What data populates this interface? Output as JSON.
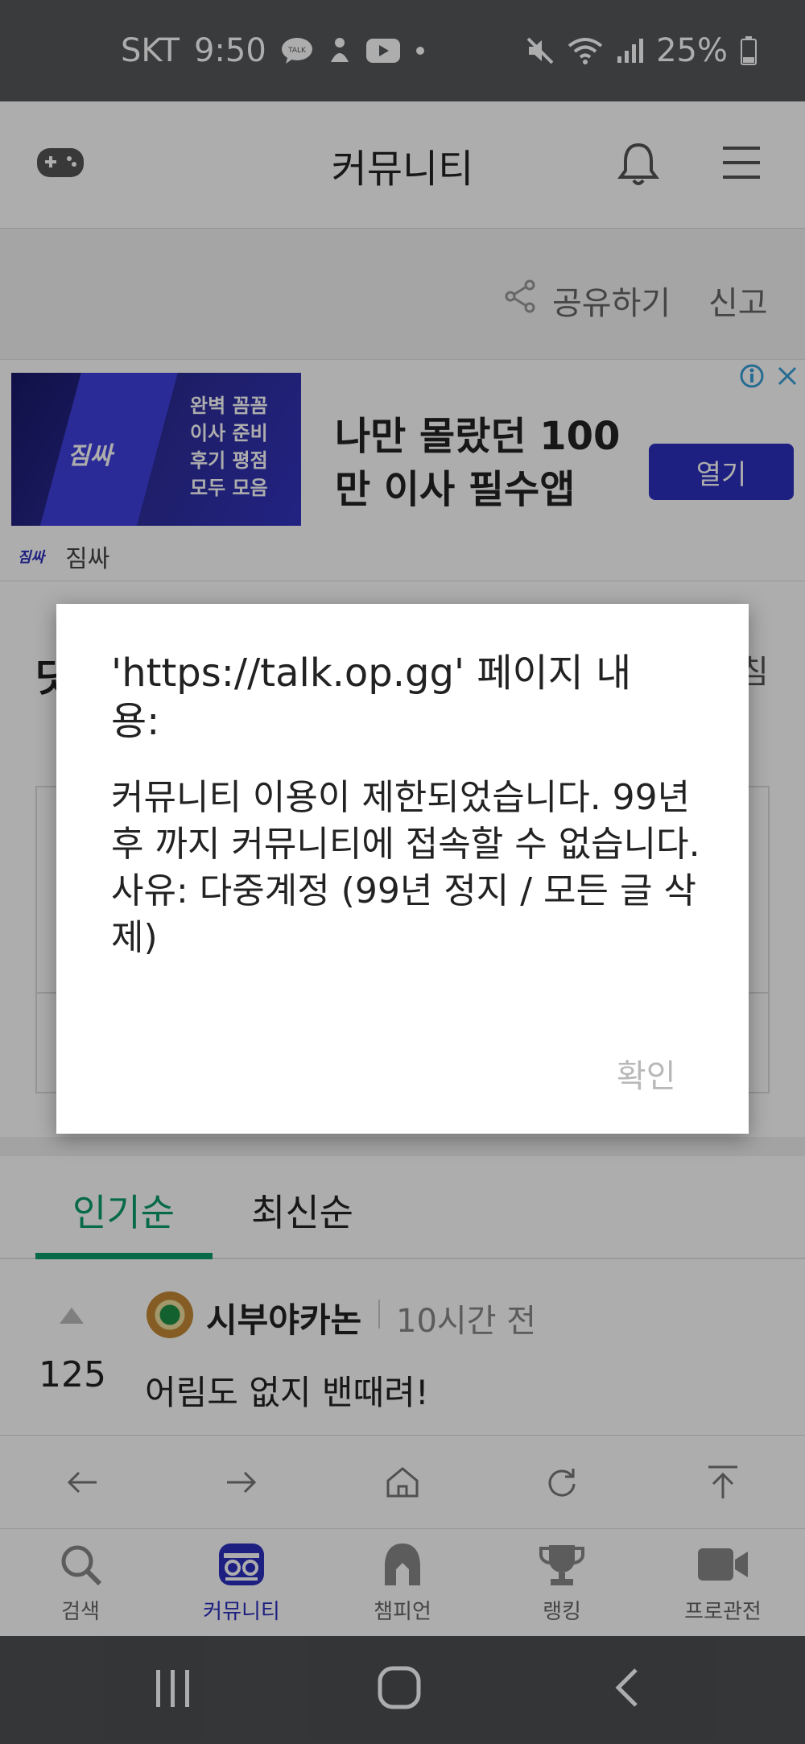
{
  "status_bar": {
    "carrier": "SKT",
    "time": "9:50",
    "talk_badge": "TALK",
    "battery": "25%"
  },
  "header": {
    "title": "커뮤니티"
  },
  "post_actions": {
    "share_label": "공유하기",
    "report_label": "신고"
  },
  "ad": {
    "image_logo": "짐싸",
    "image_copy": [
      "완벽 꼼꼼",
      "이사 준비",
      "후기 평점",
      "모두 모음"
    ],
    "headline": "나만 몰랐던 100만 이사 필수앱",
    "open_label": "열기",
    "sponsor_mini": "짐싸",
    "sponsor_name": "짐싸"
  },
  "background": {
    "title_fragment": "닷",
    "right_fragment": "침"
  },
  "tabs": {
    "popular": "인기순",
    "latest": "최신순"
  },
  "comment": {
    "score": "125",
    "author": "시부야카논",
    "time": "10시간 전",
    "body": "어림도 없지 밴때려!"
  },
  "bottom_nav": {
    "items": [
      {
        "label": "검색",
        "icon": "search-icon"
      },
      {
        "label": "커뮤니티",
        "icon": "community-icon",
        "active": true
      },
      {
        "label": "챔피언",
        "icon": "champion-helmet-icon"
      },
      {
        "label": "랭킹",
        "icon": "trophy-icon"
      },
      {
        "label": "프로관전",
        "icon": "video-camera-icon"
      }
    ]
  },
  "dialog": {
    "title": "'https://talk.op.gg' 페이지 내용:",
    "message": "커뮤니티 이용이 제한되었습니다. 99년 후 까지 커뮤니티에 접속할 수 없습니다.\n사유: 다중계정 (99년 정지 / 모든 글 삭제)",
    "ok_label": "확인"
  },
  "colors": {
    "accent_green": "#0a9c6d",
    "brand_blue": "#2b2fbf"
  }
}
